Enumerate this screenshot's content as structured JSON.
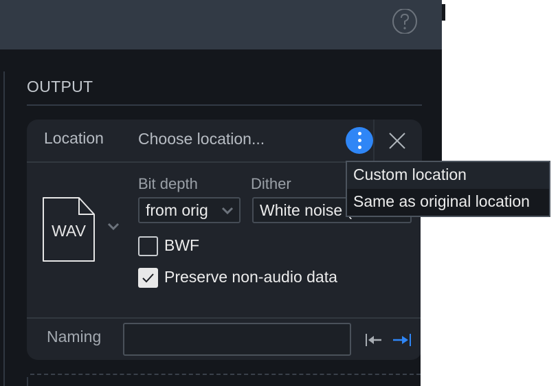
{
  "header": {
    "help_icon": "question-circle-icon"
  },
  "output_section": {
    "title": "OUTPUT",
    "location": {
      "label": "Location",
      "value": "Choose location...",
      "menu_icon": "kebab-vertical-icon",
      "close_icon": "close-x-icon"
    },
    "format": {
      "file_type": "WAV",
      "file_icon": "document-icon",
      "chevron_icon": "chevron-down-icon"
    },
    "bit_depth": {
      "label": "Bit depth",
      "value": "from orig"
    },
    "dither": {
      "label": "Dither",
      "value": "White noise ("
    },
    "bwf": {
      "label": "BWF",
      "checked": false
    },
    "preserve": {
      "label": "Preserve non-audio data",
      "checked": true
    },
    "naming": {
      "label": "Naming",
      "value": "",
      "align_left_icon": "arrow-left-to-bar-icon",
      "align_right_icon": "arrow-right-to-bar-icon"
    }
  },
  "location_menu": {
    "items": [
      {
        "label": "Custom location"
      },
      {
        "label": "Same as original location"
      }
    ]
  },
  "colors": {
    "accent": "#2f86f6",
    "topbar": "#323a45",
    "background": "#14171c",
    "card": "#20242b"
  }
}
